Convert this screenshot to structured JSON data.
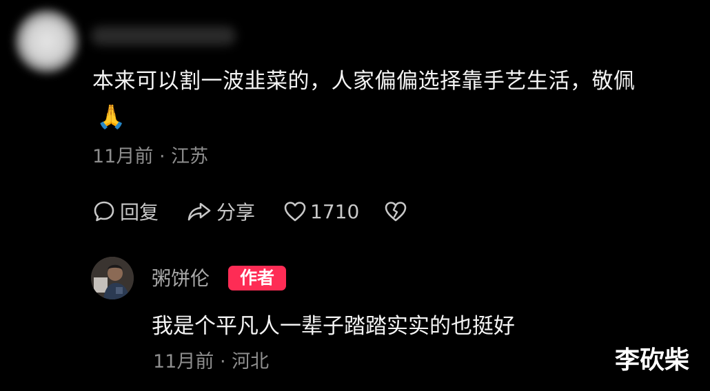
{
  "comment": {
    "text": "本来可以割一波韭菜的，人家偏偏选择靠手艺生活，敬佩",
    "emoji": "🙏",
    "meta": "11月前 · 江苏",
    "actions": {
      "reply_label": "回复",
      "share_label": "分享",
      "like_count": "1710"
    },
    "icons": [
      "chat-bubble-icon",
      "share-arrow-icon",
      "heart-icon",
      "broken-heart-icon"
    ]
  },
  "reply": {
    "user_name": "粥饼伦",
    "badge": "作者",
    "text": "我是个平凡人一辈子踏踏实实的也挺好",
    "meta": "11月前 · 河北"
  },
  "watermark": "李砍柴",
  "colors": {
    "background": "#000000",
    "badge": "#fe2c55",
    "meta_text": "#8e8e8e"
  }
}
